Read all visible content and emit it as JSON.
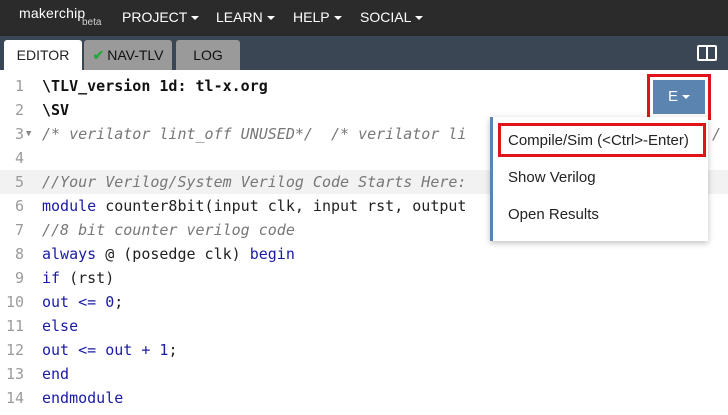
{
  "topbar": {
    "logo": "makerchip",
    "beta": "beta",
    "menus": [
      "PROJECT",
      "LEARN",
      "HELP",
      "SOCIAL"
    ]
  },
  "tabs": {
    "editor": "EDITOR",
    "navtlv": "NAV-TLV",
    "log": "LOG"
  },
  "editor": {
    "line_numbers": [
      "1",
      "2",
      "3",
      "4",
      "5",
      "6",
      "7",
      "8",
      "9",
      "10",
      "11",
      "12",
      "13",
      "14"
    ],
    "lines": {
      "l1": "\\TLV_version 1d: tl-x.org",
      "l2": "\\SV",
      "l3": "/* verilator lint_off UNUSED*/  /* verilator li",
      "l3_tail": "/",
      "l5": "//Your Verilog/System Verilog Code Starts Here:",
      "l6_a": "module ",
      "l6_b": "counter8bit(input clk, input rst, output",
      "l7": "//8 bit counter verilog code",
      "l8_a": "always",
      "l8_b": " @ (posedge clk) ",
      "l8_c": "begin",
      "l9_a": "if",
      "l9_b": " (rst)",
      "l10_a": "out <= ",
      "l10_b": "0",
      "l10_c": ";",
      "l11": "else",
      "l12_a": "out <= out + ",
      "l12_b": "1",
      "l12_c": ";",
      "l13": "end",
      "l14": "endmodule"
    }
  },
  "e_menu": {
    "button_label": "E",
    "items": [
      "Compile/Sim (<Ctrl>-Enter)",
      "Show Verilog",
      "Open Results"
    ]
  },
  "colors": {
    "topbar": "#2b2b2b",
    "tabbar": "#3a4654",
    "accent": "#5b84b1",
    "highlight_border": "#e0121a",
    "check_green": "#27a83f"
  },
  "icons": [
    "check-icon",
    "split-view-icon",
    "chevron-down-icon",
    "fold-arrow-icon"
  ]
}
